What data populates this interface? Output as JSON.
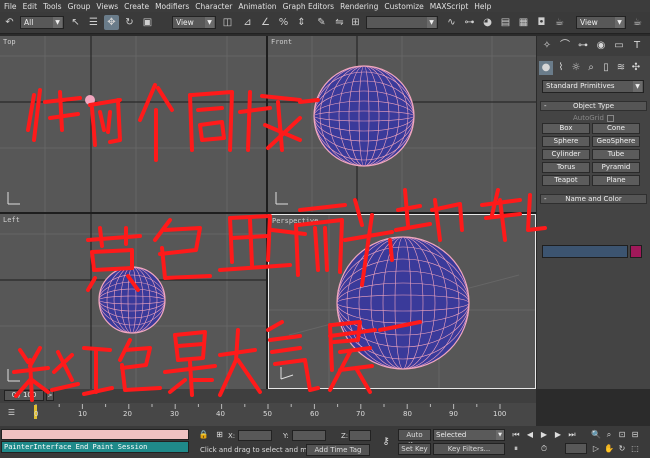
{
  "menubar": {
    "items": [
      "File",
      "Edit",
      "Tools",
      "Group",
      "Views",
      "Create",
      "Modifiers",
      "Character",
      "Animation",
      "Graph Editors",
      "Rendering",
      "Customize",
      "MAXScript",
      "Help"
    ]
  },
  "toolbar": {
    "selection_filter": "All",
    "ref_coord": "View",
    "named_selection": "",
    "view_drop_right": "View"
  },
  "viewports": {
    "top": {
      "label": "Top"
    },
    "front": {
      "label": "Front"
    },
    "left": {
      "label": "Left"
    },
    "perspective": {
      "label": "Perspective"
    }
  },
  "command_panel": {
    "category": "Standard Primitives",
    "object_type": {
      "title": "Object Type",
      "autogrid": "AutoGrid",
      "buttons": [
        "Box",
        "Cone",
        "Sphere",
        "GeoSphere",
        "Cylinder",
        "Tube",
        "Torus",
        "Pyramid",
        "Teapot",
        "Plane"
      ]
    },
    "name_color": {
      "title": "Name and Color",
      "color": "#a0195a"
    }
  },
  "timeline": {
    "frame_display": "0 / 100",
    "ticks": [
      "0",
      "10",
      "20",
      "30",
      "40",
      "50",
      "60",
      "70",
      "80",
      "90",
      "100"
    ]
  },
  "status": {
    "script_output": "PainterInterface End Paint Session",
    "x_label": "X:",
    "y_label": "Y:",
    "z_label": "Z:",
    "prompt": "Click and drag to select and move",
    "add_time_tag": "Add Time Tag",
    "auto_key": "Auto Key",
    "set_key": "Set Key",
    "selected": "Selected",
    "key_filters": "Key Filters..."
  },
  "annotations": {
    "line1": "做两个圆球",
    "line2": "黄色里面为地球",
    "line3": "粉红色是大气层"
  }
}
